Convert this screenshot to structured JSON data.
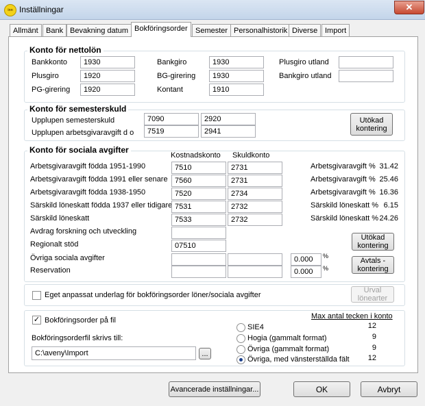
{
  "window": {
    "title": "Inställningar",
    "icon_text": "inn",
    "close_glyph": "✕"
  },
  "tabs": [
    "Allmänt",
    "Bank",
    "Bevakning datum",
    "Bokföringsorder",
    "Semester",
    "Personalhistorik",
    "Diverse",
    "Import"
  ],
  "nettolon": {
    "title": "Konto för nettolön",
    "bankkonto": {
      "label": "Bankkonto",
      "value": "1930"
    },
    "plusgiro": {
      "label": "Plusgiro",
      "value": "1920"
    },
    "pg_girering": {
      "label": "PG-girering",
      "value": "1920"
    },
    "bankgiro": {
      "label": "Bankgiro",
      "value": "1930"
    },
    "bg_girering": {
      "label": "BG-girering",
      "value": "1930"
    },
    "kontant": {
      "label": "Kontant",
      "value": "1910"
    },
    "plusgiro_utland": {
      "label": "Plusgiro utland",
      "value": ""
    },
    "bankgiro_utland": {
      "label": "Bankgiro utland",
      "value": ""
    }
  },
  "semesterskuld": {
    "title": "Konto för semesterskuld",
    "row1": {
      "label": "Upplupen semesterskuld",
      "v1": "7090",
      "v2": "2920"
    },
    "row2": {
      "label": "Upplupen arbetsgivaravgift d o",
      "v1": "7519",
      "v2": "2941"
    },
    "button": "Utökad kontering"
  },
  "sociala": {
    "title": "Konto för sociala avgifter",
    "col1": "Kostnadskonto",
    "col2": "Skuldkonto",
    "rows": [
      {
        "label": "Arbetsgivaravgift födda 1951-1990",
        "kost": "7510",
        "skuld": "2731",
        "rlabel": "Arbetsgivaravgift %",
        "pct": "31.42"
      },
      {
        "label": "Arbetsgivaravgift födda 1991 eller senare",
        "kost": "7560",
        "skuld": "2731",
        "rlabel": "Arbetsgivaravgift %",
        "pct": "25.46"
      },
      {
        "label": "Arbetsgivaravgift födda 1938-1950",
        "kost": "7520",
        "skuld": "2734",
        "rlabel": "Arbetsgivaravgift %",
        "pct": "16.36"
      },
      {
        "label": "Särskild löneskatt födda 1937 eller tidigare",
        "kost": "7531",
        "skuld": "2732",
        "rlabel": "Särskild löneskatt %",
        "pct": "6.15"
      },
      {
        "label": "Särskild löneskatt",
        "kost": "7533",
        "skuld": "2732",
        "rlabel": "Särskild löneskatt %",
        "pct": "24.26"
      }
    ],
    "avdrag": {
      "label": "Avdrag forskning och utveckling",
      "kost": ""
    },
    "regionalt": {
      "label": "Regionalt stöd",
      "kost": "07510"
    },
    "ovriga": {
      "label": "Övriga sociala avgifter",
      "kost": "",
      "skuld": "",
      "pct": "0.000",
      "pct_sign": "%"
    },
    "reservation": {
      "label": "Reservation",
      "kost": "",
      "skuld": "",
      "pct": "0.000",
      "pct_sign": "%"
    },
    "btn_utokad": "Utökad kontering",
    "btn_avtals": "Avtals - kontering"
  },
  "eget": {
    "label": "Eget anpassat underlag för bokföringsorder löner/sociala avgifter",
    "checked": false,
    "button": "Urval lönearter"
  },
  "fil": {
    "check_label": "Bokföringsorder på fil",
    "check_mark": "✓",
    "path_label": "Bokföringsorderfil skrivs till:",
    "path": "C:\\aveny\\Import",
    "browse": "...",
    "max_header": "Max antal tecken i konto",
    "formats": [
      {
        "label": "SIE4",
        "max": "12",
        "selected": false
      },
      {
        "label": "Hogia (gammalt format)",
        "max": "9",
        "selected": false
      },
      {
        "label": "Övriga (gammalt format)",
        "max": "9",
        "selected": false
      },
      {
        "label": "Övriga, med vänsterställda fält",
        "max": "12",
        "selected": true
      }
    ]
  },
  "footer": {
    "advanced": "Avancerade inställningar...",
    "ok": "OK",
    "cancel": "Avbryt"
  }
}
